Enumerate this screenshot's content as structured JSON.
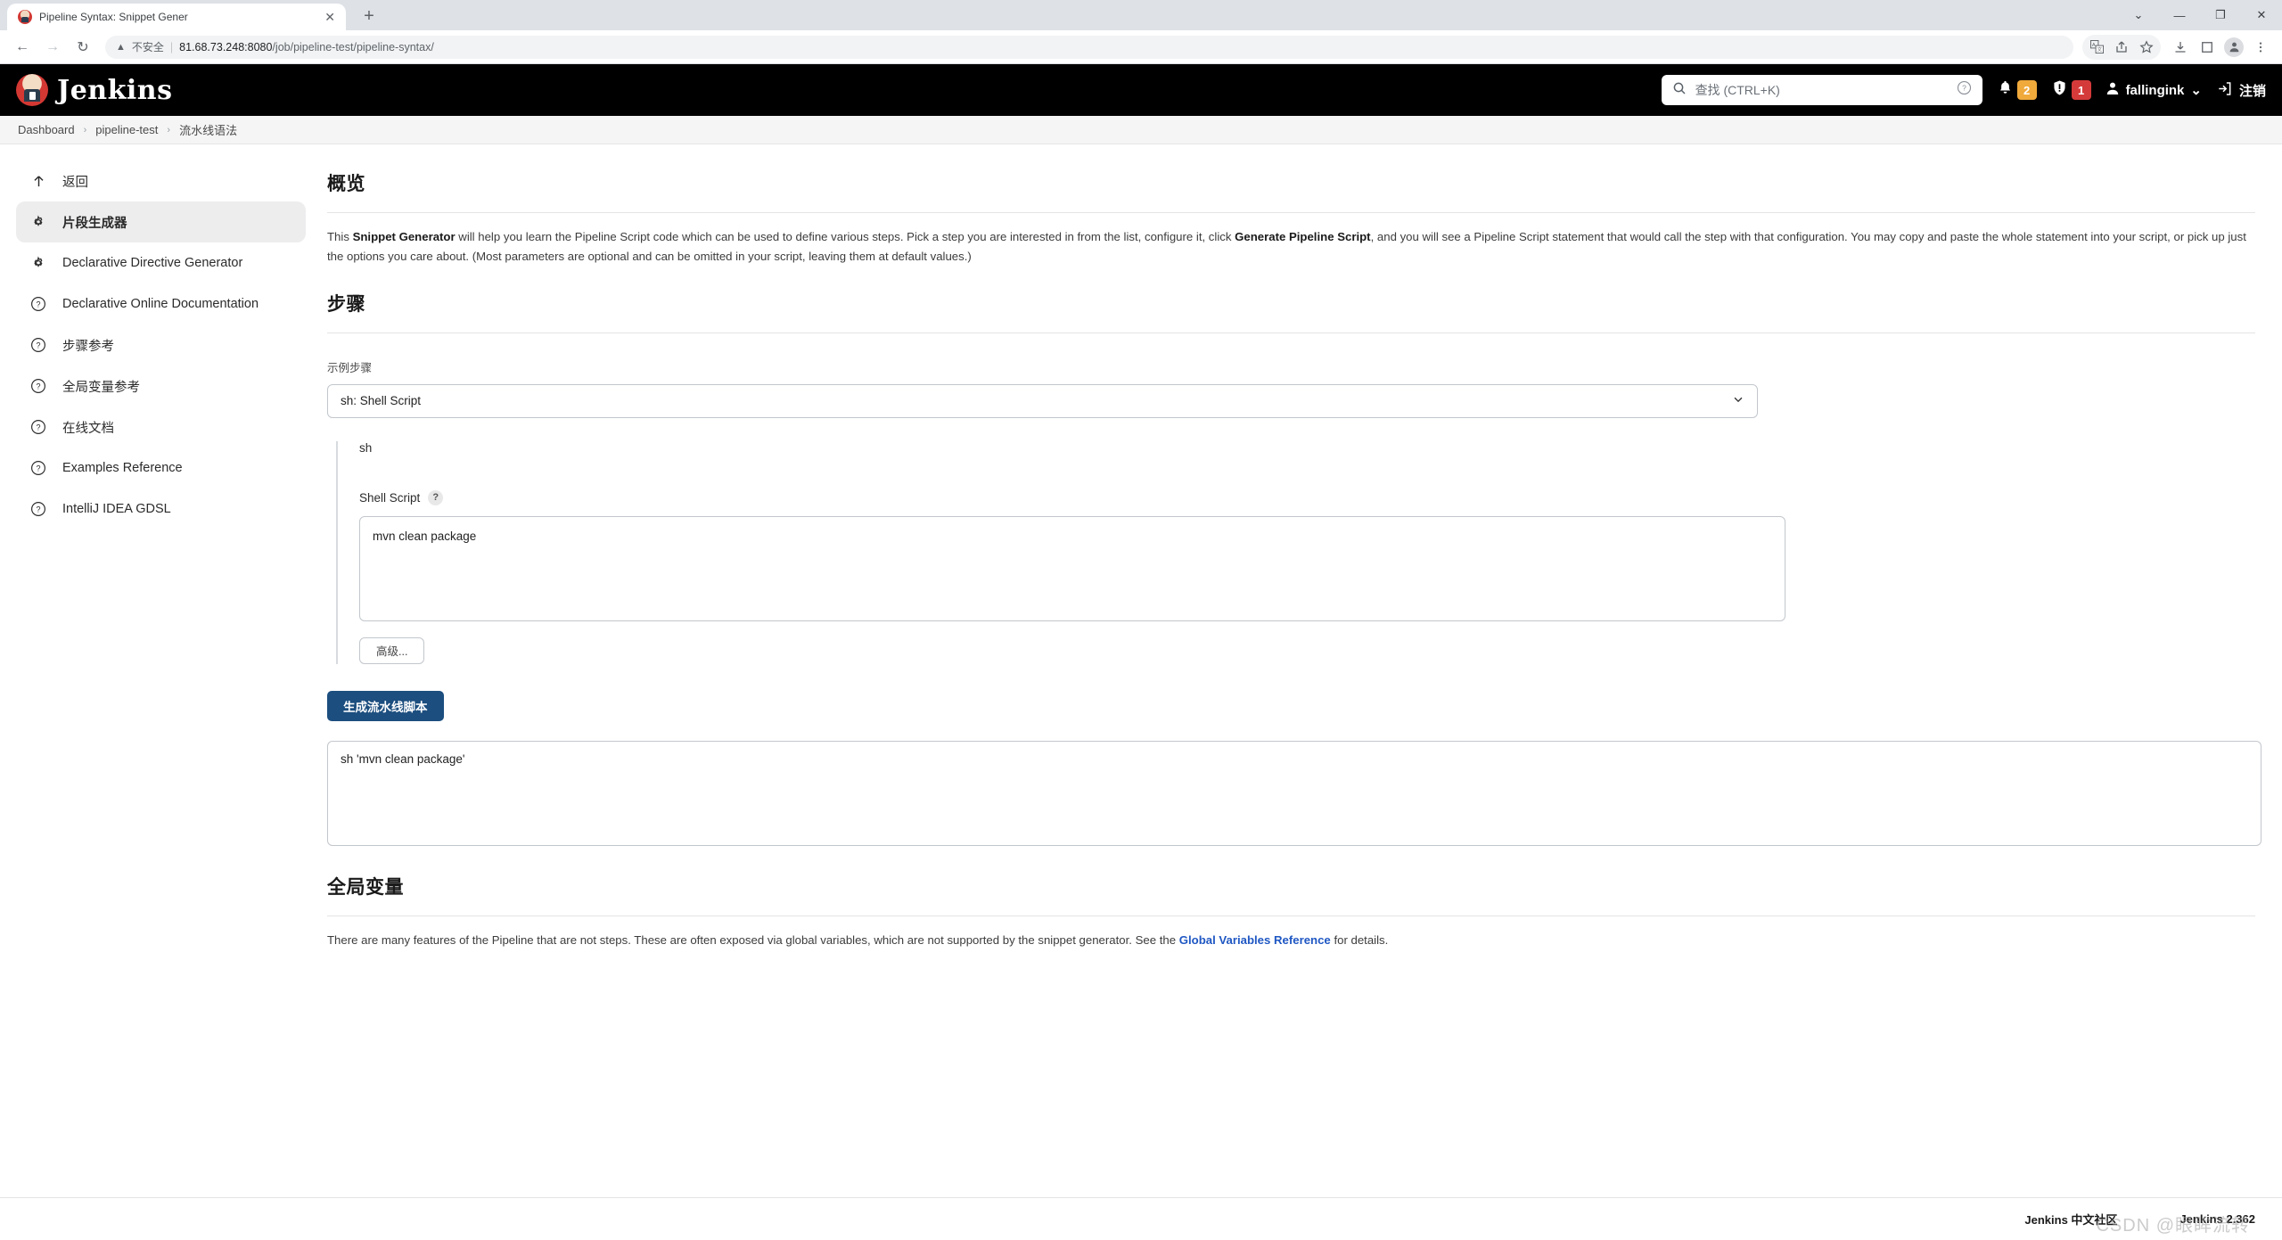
{
  "browser": {
    "tab": {
      "title": "Pipeline Syntax: Snippet Gener",
      "close_icon": "close-icon",
      "favicon": "jenkins-favicon"
    },
    "new_tab_label": "+",
    "window_controls": {
      "collapse": "⌄",
      "minimize": "—",
      "maximize": "❐",
      "close": "✕"
    },
    "nav": {
      "back": "←",
      "forward": "→",
      "reload": "↻"
    },
    "omnibox": {
      "warning_icon": "warning-triangle-icon",
      "insecure_label": "不安全",
      "divider": "|",
      "url_host": "81.68.73.248:8080",
      "url_path": "/job/pipeline-test/pipeline-syntax/"
    },
    "toolbar_icons": [
      "translate-icon",
      "share-icon",
      "bookmark-star-icon",
      "download-icon",
      "extensions-icon",
      "profile-avatar-icon",
      "menu-kebab-icon"
    ]
  },
  "header": {
    "logo_text": "Jenkins",
    "search": {
      "icon": "search-icon",
      "placeholder": "查找 (CTRL+K)",
      "help_icon": "help-circle-icon"
    },
    "notifications": {
      "icon": "bell-icon",
      "count": "2",
      "color": "#f0a93b"
    },
    "security": {
      "icon": "shield-alert-icon",
      "count": "1",
      "color": "#d53a3a"
    },
    "user": {
      "icon": "person-icon",
      "name": "fallingink",
      "chevron": "⌄"
    },
    "logout": {
      "icon": "logout-icon",
      "label": "注销"
    }
  },
  "breadcrumb": {
    "items": [
      {
        "label": "Dashboard"
      },
      {
        "label": "pipeline-test"
      },
      {
        "label": "流水线语法"
      }
    ],
    "separator": "›"
  },
  "sidebar": {
    "items": [
      {
        "label": "返回",
        "icon": "arrow-up-icon",
        "active": false
      },
      {
        "label": "片段生成器",
        "icon": "gear-icon",
        "active": true
      },
      {
        "label": "Declarative Directive Generator",
        "icon": "gear-icon",
        "active": false
      },
      {
        "label": "Declarative Online Documentation",
        "icon": "help-circle-icon",
        "active": false
      },
      {
        "label": "步骤参考",
        "icon": "help-circle-icon",
        "active": false
      },
      {
        "label": "全局变量参考",
        "icon": "help-circle-icon",
        "active": false
      },
      {
        "label": "在线文档",
        "icon": "help-circle-icon",
        "active": false
      },
      {
        "label": "Examples Reference",
        "icon": "help-circle-icon",
        "active": false
      },
      {
        "label": "IntelliJ IDEA GDSL",
        "icon": "help-circle-icon",
        "active": false
      }
    ]
  },
  "main": {
    "overview": {
      "heading": "概览",
      "p_1": "This ",
      "p_bold_1": "Snippet Generator",
      "p_2": " will help you learn the Pipeline Script code which can be used to define various steps. Pick a step you are interested in from the list, configure it, click ",
      "p_bold_2": "Generate Pipeline Script",
      "p_3": ", and you will see a Pipeline Script statement that would call the step with that configuration. You may copy and paste the whole statement into your script, or pick up just the options you care about. (Most parameters are optional and can be omitted in your script, leaving them at default values.)"
    },
    "steps": {
      "heading": "步骤",
      "select_label": "示例步骤",
      "select_value": "sh: Shell Script",
      "select_chevron": "⌄",
      "nested_title": "sh",
      "script_label": "Shell Script",
      "script_help": "?",
      "script_value": "mvn clean package",
      "advanced_button": "高级...",
      "generate_button": "生成流水线脚本",
      "output_value": "sh 'mvn clean package'"
    },
    "globals": {
      "heading": "全局变量",
      "p_1": "There are many features of the Pipeline that are not steps. These are often exposed via global variables, which are not supported by the snippet generator. See the ",
      "link": "Global Variables Reference",
      "p_2": " for details."
    }
  },
  "footer": {
    "community": "Jenkins 中文社区",
    "version": "Jenkins 2.362",
    "watermark": "CSDN @眼眸流转"
  },
  "colors": {
    "accent": "#1c4e7f",
    "link": "#1f57c3",
    "header_bg": "#000000"
  }
}
